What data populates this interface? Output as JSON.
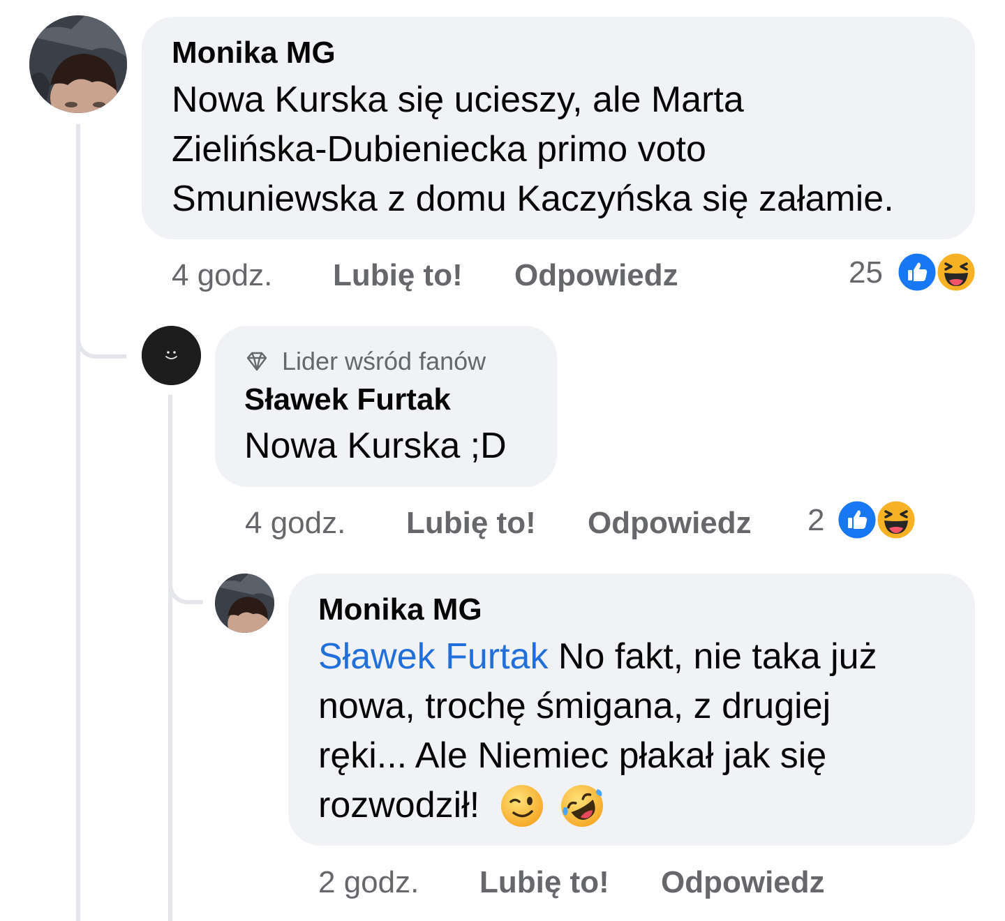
{
  "comments": [
    {
      "author": "Monika MG",
      "text_lines": [
        "Nowa Kurska się ucieszy, ale Marta",
        "Zielińska-Dubieniecka primo voto",
        "Smuniewska z domu Kaczyńska się załamie."
      ],
      "time": "4 godz.",
      "like_label": "Lubię to!",
      "reply_label": "Odpowiedz",
      "reaction_count": "25"
    },
    {
      "badge": "Lider wśród fanów",
      "author": "Sławek Furtak",
      "text": "Nowa Kurska ;D",
      "time": "4 godz.",
      "like_label": "Lubię to!",
      "reply_label": "Odpowiedz",
      "reaction_count": "2"
    },
    {
      "author": "Monika MG",
      "mention": "Sławek Furtak",
      "text_lines": [
        " No fakt, nie taka już",
        "nowa, trochę śmigana, z drugiej",
        "ręki... Ale Niemiec płakał jak się",
        "rozwodził! "
      ],
      "time": "2 godz.",
      "like_label": "Lubię to!",
      "reply_label": "Odpowiedz"
    }
  ],
  "icons": {
    "like": "like-reaction-icon",
    "haha": "haha-reaction-icon",
    "badge": "diamond-icon",
    "wink": "wink-emoji",
    "rofl": "rolling-laughing-emoji"
  },
  "colors": {
    "like_blue": "#1877f2",
    "mention_blue": "#216fdb",
    "bubble": "#f0f2f5",
    "meta_gray": "#65676b",
    "haha_yellow": "#f7b125"
  }
}
